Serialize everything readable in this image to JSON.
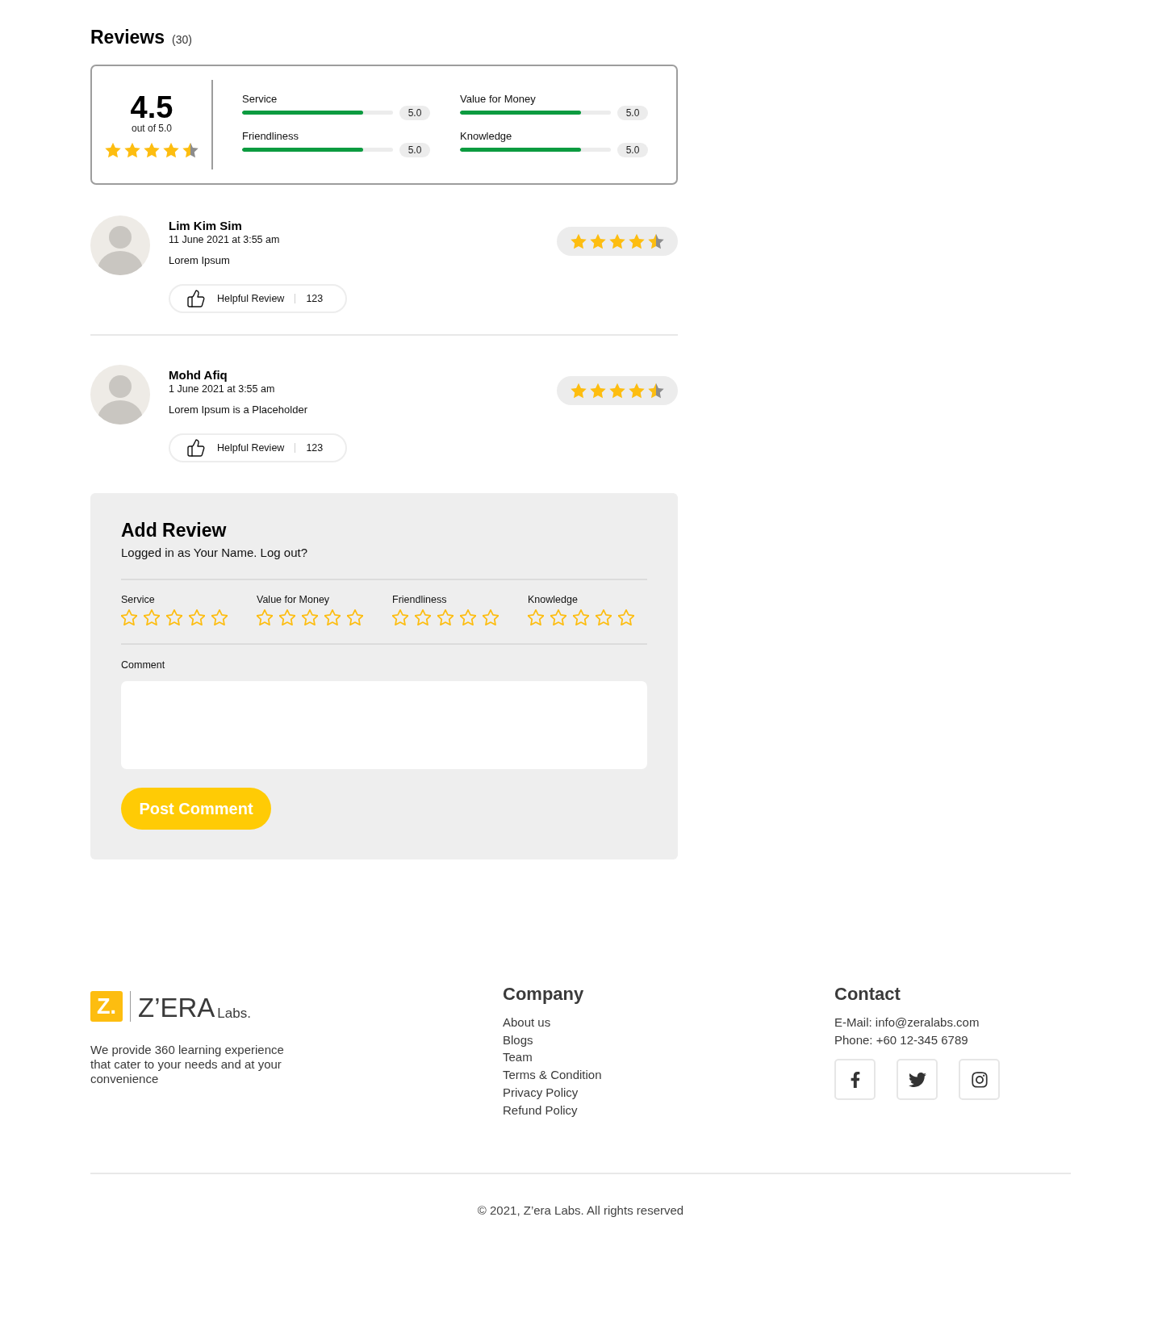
{
  "reviews_header": {
    "title": "Reviews",
    "count": "(30)"
  },
  "summary": {
    "score": "4.5",
    "scale": "out of 5.0",
    "stars": 4.5,
    "categories": [
      {
        "label": "Service",
        "level": 0.8,
        "reading": "5.0"
      },
      {
        "label": "Value for Money",
        "level": 0.8,
        "reading": "5.0"
      },
      {
        "label": "Friendliness",
        "level": 0.8,
        "reading": "5.0"
      },
      {
        "label": "Knowledge",
        "level": 0.8,
        "reading": "5.0"
      }
    ]
  },
  "reviews": [
    {
      "name": "Lim Kim Sim",
      "date": "11 June 2021 at 3:55 am",
      "text": "Lorem Ipsum",
      "stars": 4.5,
      "helpful": {
        "label": "Helpful Review",
        "count": "123"
      }
    },
    {
      "name": "Mohd Afiq",
      "date": "1 June 2021 at 3:55 am",
      "text": "Lorem Ipsum is a Placeholder",
      "stars": 4.5,
      "helpful": {
        "label": "Helpful Review",
        "count": "123"
      }
    }
  ],
  "add_review": {
    "title": "Add Review",
    "status": "Logged in as Your Name. Log out?",
    "ratings": [
      {
        "label": "Service",
        "stars": 0
      },
      {
        "label": "Value for Money",
        "stars": 0
      },
      {
        "label": "Friendliness",
        "stars": 0
      },
      {
        "label": "Knowledge",
        "stars": 0
      }
    ],
    "comment": {
      "label": "Comment"
    },
    "submit": "Post Comment"
  },
  "footer": {
    "logo": {
      "mark": "Z.",
      "name": "Z’ERA",
      "suffix": "Labs."
    },
    "tagline": "We provide 360 learning experience that cater to your needs and at your convenience",
    "company": {
      "title": "Company",
      "links": [
        "About us",
        "Blogs",
        "Team",
        "Terms & Condition",
        "Privacy Policy",
        "Refund Policy"
      ]
    },
    "contact": {
      "title": "Contact",
      "email": "E-Mail: info@zeralabs.com",
      "phone": "Phone: +60 12-345 6789",
      "social": [
        {
          "kind": "facebook"
        },
        {
          "kind": "twitter"
        },
        {
          "kind": "instagram"
        }
      ]
    },
    "copyright": "© 2021, Z’era Labs. All rights reserved"
  }
}
